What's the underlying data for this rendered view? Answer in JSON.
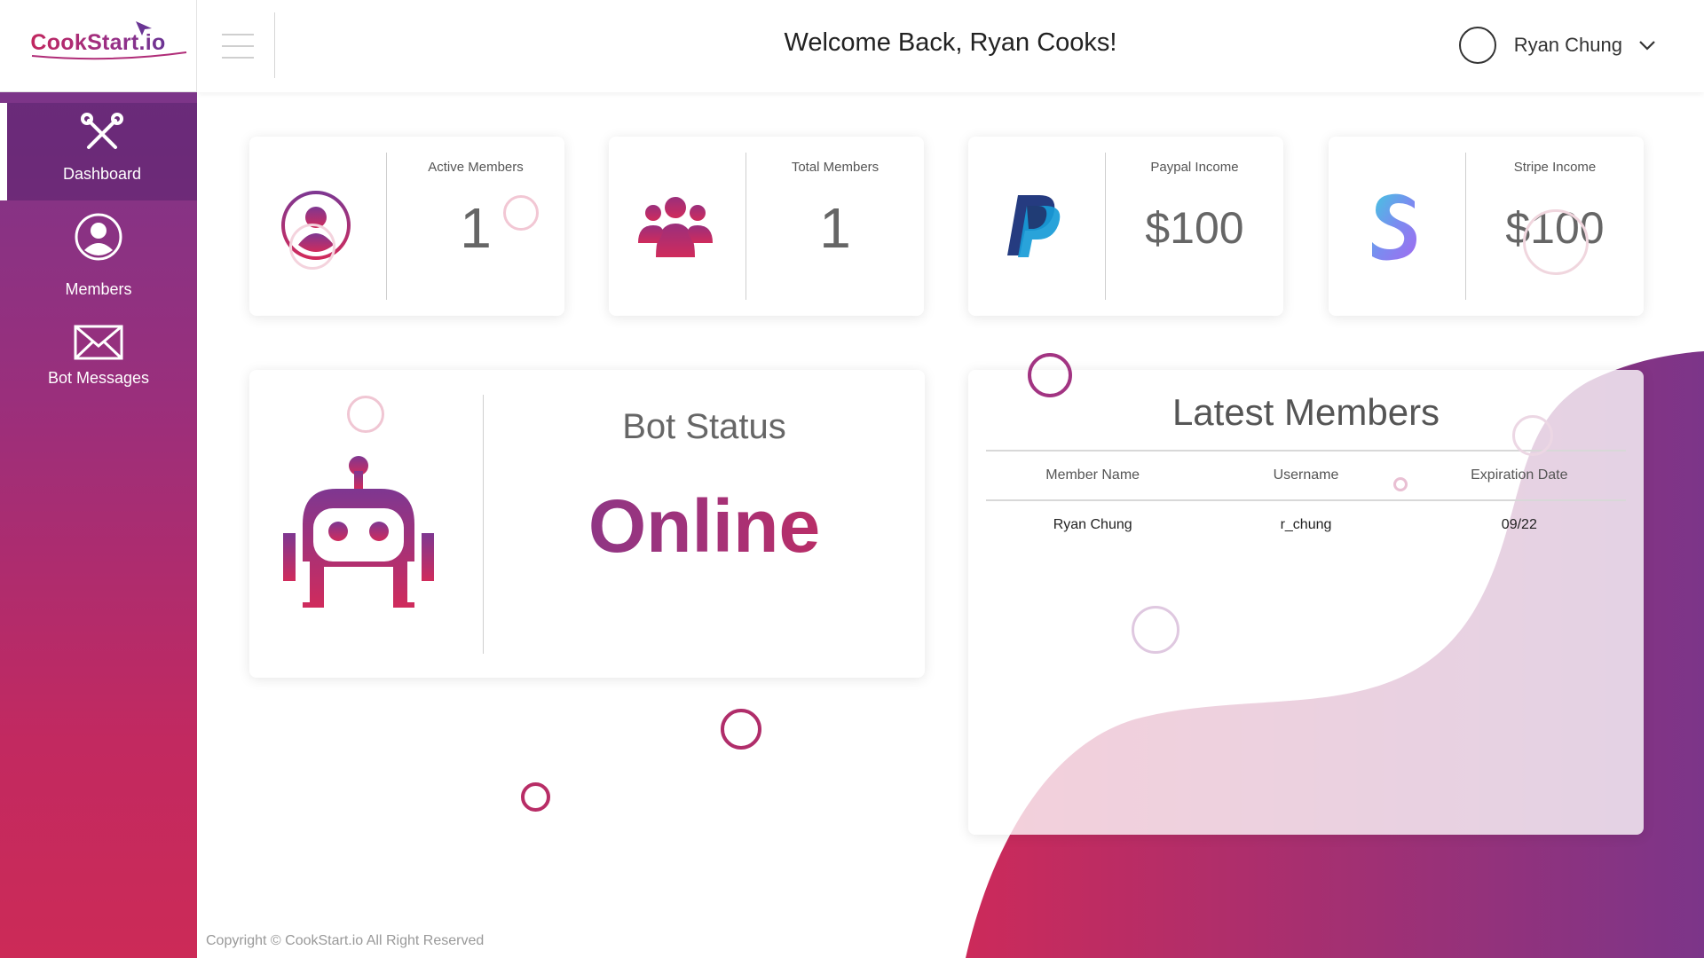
{
  "brand": {
    "logo_text": "CookStart.io",
    "accent_gradient": [
      "#c2275e",
      "#7c3589"
    ]
  },
  "sidebar": {
    "items": [
      {
        "label": "Dashboard",
        "icon": "tools-icon",
        "active": true
      },
      {
        "label": "Members",
        "icon": "user-circle-icon",
        "active": false
      },
      {
        "label": "Bot Messages",
        "icon": "envelope-icon",
        "active": false
      }
    ]
  },
  "header": {
    "menu_icon": "hamburger-icon",
    "welcome": "Welcome Back, Ryan Cooks!",
    "user_name": "Ryan Chung"
  },
  "stats": [
    {
      "label": "Active Members",
      "value": "1",
      "icon": "user-circle-icon"
    },
    {
      "label": "Total Members",
      "value": "1",
      "icon": "users-group-icon"
    },
    {
      "label": "Paypal Income",
      "value": "$100",
      "icon": "paypal-icon"
    },
    {
      "label": "Stripe Income",
      "value": "$100",
      "icon": "stripe-icon"
    }
  ],
  "bot": {
    "title": "Bot Status",
    "status": "Online",
    "icon": "robot-icon"
  },
  "latest_members": {
    "title": "Latest Members",
    "columns": [
      "Member Name",
      "Username",
      "Expiration Date"
    ],
    "rows": [
      [
        "Ryan Chung",
        "r_chung",
        "09/22"
      ]
    ]
  },
  "footer": {
    "copyright": "Copyright © CookStart.io All Right Reserved"
  }
}
